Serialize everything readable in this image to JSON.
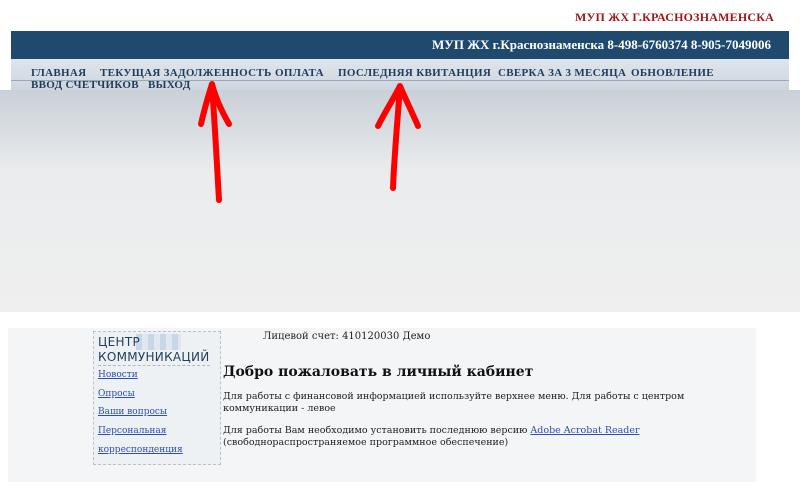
{
  "brand": "МУП ЖХ Г.КРАСНОЗНАМЕНСКА",
  "header": {
    "text": "МУП ЖХ г.Краснознаменска 8-498-6760374 8-905-7049006"
  },
  "nav": {
    "items": [
      "ГЛАВНАЯ",
      "ТЕКУЩАЯ ЗАДОЛЖЕННОСТЬ",
      "ОПЛАТА",
      "ПОСЛЕДНЯЯ КВИТАНЦИЯ",
      "СВЕРКА ЗА 3 МЕСЯЦА",
      "ОБНОВЛЕНИЕ",
      "ВВОД СЧЕТЧИКОВ",
      "ВЫХОД"
    ]
  },
  "sidebar": {
    "title_line1": "ЦЕНТР",
    "title_line2": "КОММУНИКАЦИЙ",
    "links": [
      "Новости",
      "Опросы",
      "Ваши вопросы",
      "Персональная",
      "корреспонденция"
    ]
  },
  "main": {
    "account": "Лицевой счет: 410120030 Демо",
    "welcome": "Добро пожаловать в личный кабинет",
    "para1": "Для работы с финансовой информацией используйте верхнее меню. Для работы с центром коммуникации - левое",
    "para2_prefix": "Для работы Вам необходимо установить последнюю версию",
    "para2_link": "Adobe Acrobat Reader",
    "para2_suffix": "(свободнораспространяемое программное обеспечение)"
  },
  "colors": {
    "header_bg": "#1f4a6e",
    "brand": "#a01818",
    "nav_text": "#1e3d5c",
    "link": "#2b4fb3",
    "arrow": "#ff0000"
  },
  "annotations": {
    "arrows": 2,
    "arrow_color": "red"
  }
}
